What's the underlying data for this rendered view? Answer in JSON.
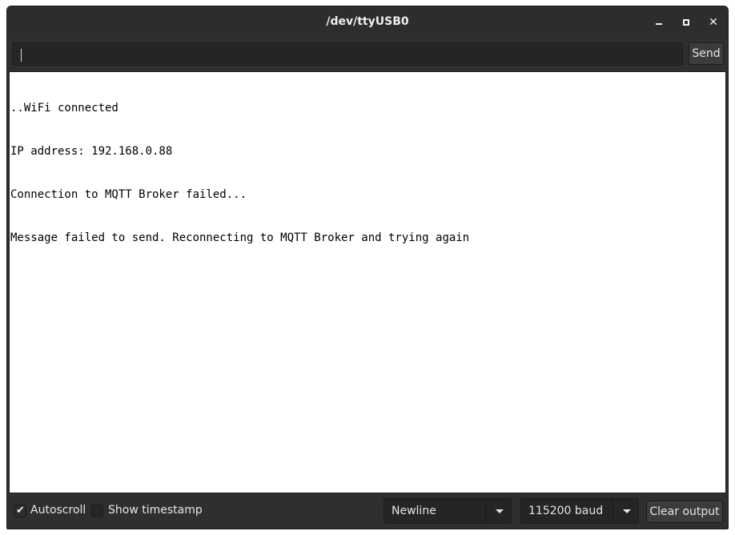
{
  "window": {
    "title": "/dev/ttyUSB0",
    "controls": [
      "minimize-icon",
      "maximize-icon",
      "close-icon"
    ]
  },
  "toolbar": {
    "input_value": "",
    "send_label": "Send"
  },
  "output": {
    "lines": [
      "..WiFi connected",
      "IP address: 192.168.0.88",
      "Connection to MQTT Broker failed...",
      "Message failed to send. Reconnecting to MQTT Broker and trying again"
    ]
  },
  "status": {
    "autoscroll": {
      "label": "Autoscroll",
      "checked": true
    },
    "timestamp": {
      "label": "Show timestamp",
      "checked": false
    },
    "line_ending": {
      "selected": "Newline"
    },
    "baud_rate": {
      "selected": "115200 baud"
    },
    "clear_label": "Clear output"
  },
  "colors": {
    "window_bg": "#2d2f30",
    "input_bg": "#232526",
    "output_bg": "#ffffff",
    "text_light": "#e6e6e6"
  }
}
